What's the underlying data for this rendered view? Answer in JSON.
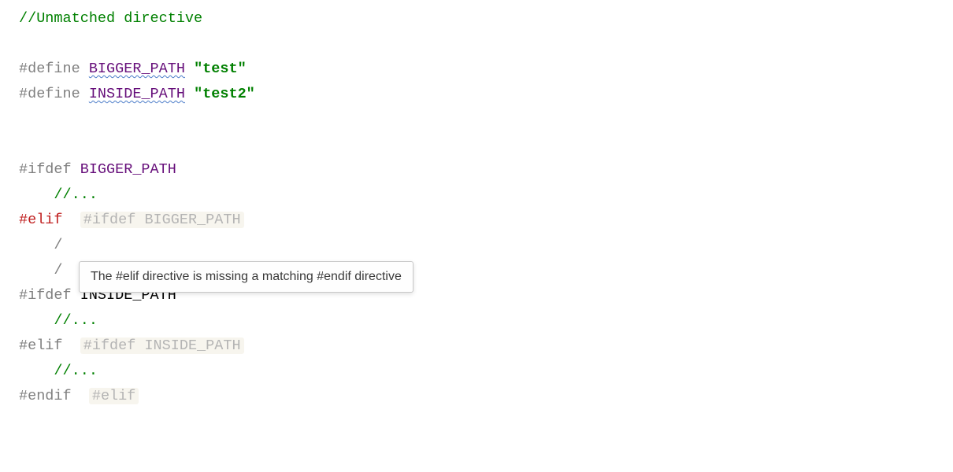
{
  "code": {
    "title_comment": "//Unmatched directive",
    "line_define1": {
      "kw": "#define ",
      "macro": "BIGGER_PATH",
      "sep": " ",
      "str": "\"test\""
    },
    "line_define2": {
      "kw": "#define ",
      "macro": "INSIDE_PATH",
      "sep": " ",
      "str": "\"test2\""
    },
    "line_ifdef1": {
      "kw": "#ifdef ",
      "macro": "BIGGER_PATH"
    },
    "line_comment_dots": "//...",
    "line_elif1": {
      "kw": "#elif",
      "hint": "#ifdef BIGGER_PATH"
    },
    "line_obscured_slash": "/",
    "line_ifdef2": {
      "kw": "#ifdef ",
      "id": "INSIDE_PATH"
    },
    "line_elif2": {
      "kw": "#elif",
      "hint": "#ifdef INSIDE_PATH"
    },
    "line_endif": {
      "kw": "#endif",
      "hint": "#elif"
    }
  },
  "tooltip": {
    "text": "The #elif directive is missing a matching #endif directive"
  }
}
